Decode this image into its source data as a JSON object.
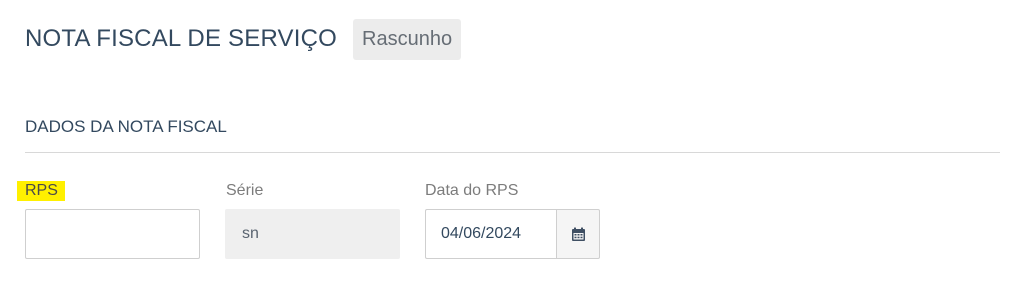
{
  "header": {
    "title": "NOTA FISCAL DE SERVIÇO",
    "status": "Rascunho"
  },
  "section": {
    "title": "DADOS DA NOTA FISCAL"
  },
  "fields": {
    "rps": {
      "label": "RPS",
      "value": ""
    },
    "serie": {
      "label": "Série",
      "value": "sn"
    },
    "data_rps": {
      "label": "Data do RPS",
      "value": "04/06/2024",
      "icon": "calendar-icon"
    }
  },
  "colors": {
    "title": "#33495f",
    "highlight": "#fff000",
    "badge_bg": "#ececec"
  }
}
